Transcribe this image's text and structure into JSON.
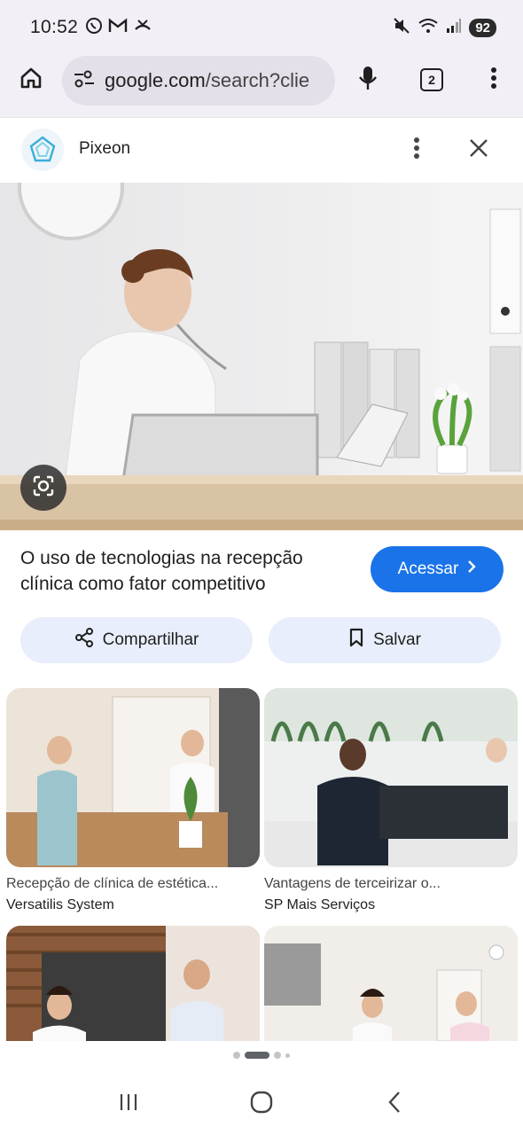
{
  "status": {
    "time": "10:52",
    "battery": "92",
    "left_icons": [
      "whatsapp-icon",
      "gmail-icon",
      "missed-call-icon"
    ],
    "right_icons": [
      "mute-icon",
      "wifi-icon",
      "signal-icon",
      "battery-icon"
    ]
  },
  "toolbar": {
    "url_domain": "google.com",
    "url_path": "/search?clie",
    "tab_count": "2",
    "icons": [
      "home-icon",
      "site-settings-icon",
      "microphone-icon",
      "tab-switcher-icon",
      "more-vert-icon"
    ]
  },
  "panel": {
    "site_name": "Pixeon",
    "icons": [
      "pixeon-logo-icon",
      "more-vert-icon",
      "close-icon"
    ]
  },
  "result": {
    "title": "O uso de tecnologias na recepção clínica como fator competitivo",
    "visit_label": "Acessar",
    "share_label": "Compartilhar",
    "save_label": "Salvar",
    "icons": [
      "google-lens-icon",
      "chevron-right-icon",
      "share-icon",
      "bookmark-icon"
    ]
  },
  "related": [
    {
      "title": "Recepção de clínica de estética...",
      "source": "Versatilis System"
    },
    {
      "title": "Vantagens de terceirizar o...",
      "source": "SP Mais Serviços"
    },
    {
      "title": "",
      "source": ""
    },
    {
      "title": "",
      "source": ""
    }
  ],
  "nav": {
    "icons": [
      "recents-icon",
      "home-nav-icon",
      "back-icon"
    ]
  },
  "colors": {
    "accent": "#1a73e8",
    "chrome_bg": "#f3eff6",
    "pill_bg": "#e8eefb"
  }
}
